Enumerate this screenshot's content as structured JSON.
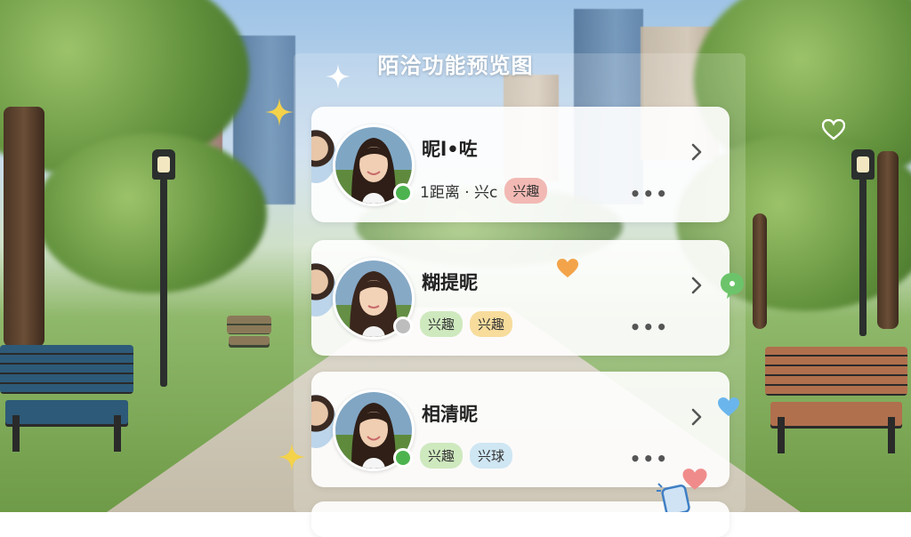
{
  "page": {
    "title": "陌洽功能预览图"
  },
  "cards": [
    {
      "name": "昵l•咗",
      "status": "online",
      "meta_text": "1距离 · 兴c",
      "tags": [
        {
          "label": "兴趣",
          "bg": "#f2b9b4"
        }
      ]
    },
    {
      "name": "糊提昵",
      "status": "offline",
      "meta_text": "",
      "tags": [
        {
          "label": "兴趣",
          "bg": "#cfe9bf"
        },
        {
          "label": "兴趣",
          "bg": "#f7dc9c"
        }
      ]
    },
    {
      "name": "相清昵",
      "status": "online",
      "meta_text": "",
      "tags": [
        {
          "label": "兴趣",
          "bg": "#cfe9bf"
        },
        {
          "label": "兴球",
          "bg": "#cfe6f3"
        }
      ]
    }
  ],
  "more_label": "•••",
  "icons": {
    "chevron": "chevron-right-icon",
    "more": "more-horizontal-icon",
    "stickers": [
      "sparkle-white",
      "sparkle-yellow",
      "heart-outline",
      "heart-orange",
      "chat-bubble-green",
      "heart-blue",
      "sparkle-yellow",
      "heart-pink",
      "phone-blue"
    ]
  },
  "colors": {
    "online": "#4cb34f",
    "offline": "#bdbdbd"
  }
}
